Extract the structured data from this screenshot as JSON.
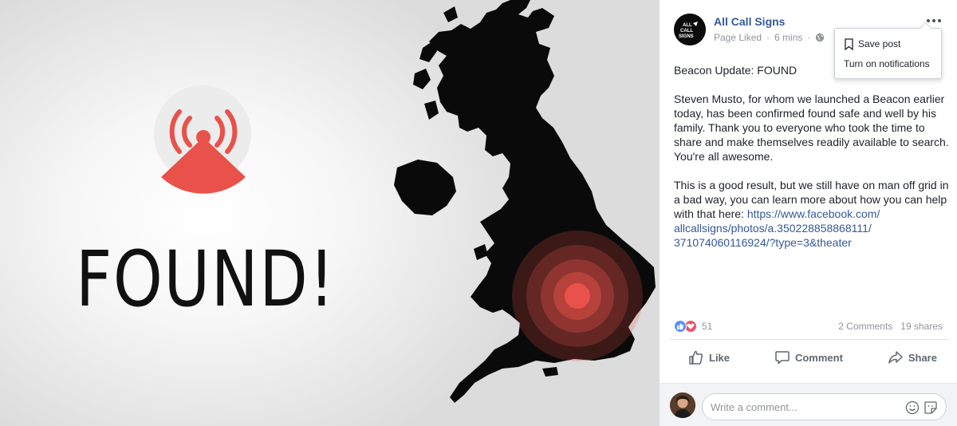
{
  "photo": {
    "headline": "FOUND!",
    "accent_color": "#e8524a",
    "icons": [
      "beacon-icon",
      "uk-map"
    ]
  },
  "post": {
    "page_name": "All Call Signs",
    "avatar_text": "ALL CALL SIGNS",
    "status": "Page Liked",
    "separator": "·",
    "time": "6 mins",
    "audience_icon": "globe-icon",
    "paragraphs": [
      "Beacon Update: FOUND",
      "Steven Musto, for whom we launched a Beacon earlier today, has been confirmed found safe and well by his family. Thank you to everyone who took the time to share and make themselves readily available to search. You're all awesome."
    ],
    "paragraph3_text": "This is a good result, but we still have on man off grid in a bad way, you can learn more about how you can help with that here: ",
    "link_line1": "https://www.facebook.com/",
    "link_line2": "allcallsigns/photos/a.350228858868111/",
    "link_line3": "371074060116924/?type=3&theater"
  },
  "menu": {
    "items": [
      "Save post",
      "Turn on notifications"
    ]
  },
  "reactions": {
    "count": "51",
    "comments": "2 Comments",
    "shares": "19 shares"
  },
  "actions": {
    "like": "Like",
    "comment": "Comment",
    "share": "Share"
  },
  "comment_box": {
    "placeholder": "Write a comment..."
  },
  "colors": {
    "link": "#365899",
    "meta": "#90949c",
    "like_blue": "#5890ff",
    "love_red": "#f25268"
  }
}
